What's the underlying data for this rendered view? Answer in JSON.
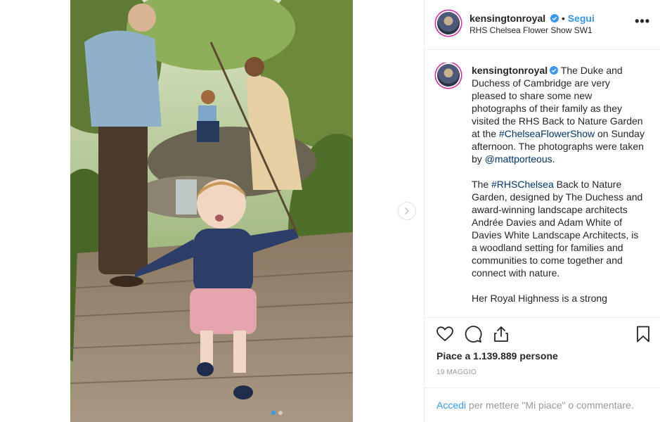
{
  "post": {
    "username": "kensingtonroyal",
    "follow_label": "Segui",
    "separator": "•",
    "location": "RHS Chelsea Flower Show SW1",
    "more_label": "•••"
  },
  "caption": {
    "username": "kensingtonroyal",
    "p1_a": " The Duke and Duchess of Cambridge are very pleased to share some new photographs of their family as they visited the RHS Back to Nature Garden at the ",
    "p1_tag": "#ChelseaFlowerShow",
    "p1_b": " on Sunday afternoon. The photographs were taken by ",
    "p1_mention": "@mattporteous",
    "p1_c": ".",
    "p2_tag": "#RHSChelsea",
    "p2_pre": "The ",
    "p2_text": " Back to Nature Garden, designed by The Duchess and award-winning landscape architects Andrée Davies and Adam White of Davies White Landscape Architects, is a woodland setting for families and communities to come together and connect with nature.",
    "p3_text": "Her Royal Highness is a strong"
  },
  "stats": {
    "likes": "Piace a 1.139.889 persone",
    "date": "19 MAGGIO"
  },
  "footer": {
    "login_link": "Accedi",
    "login_rest": " per mettere \"Mi piace\" o commentare."
  },
  "colors": {
    "link": "#3897f0",
    "hashtag": "#003569",
    "text": "#262626",
    "muted": "#999999"
  },
  "icons": [
    "heart-icon",
    "comment-icon",
    "share-icon",
    "bookmark-icon",
    "chevron-right-icon",
    "verified-icon",
    "more-icon"
  ]
}
